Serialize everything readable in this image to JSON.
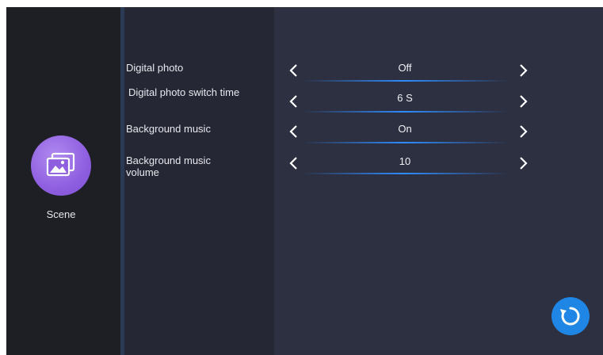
{
  "sidebar": {
    "label": "Scene",
    "icon": "photo-gallery-icon",
    "icon_color": "#8f5fe0"
  },
  "settings": [
    {
      "label": "Digital photo",
      "value": "Off"
    },
    {
      "label": "Digital photo switch time",
      "value": "6 S"
    },
    {
      "label": "Background music",
      "value": "On"
    },
    {
      "label": "Background music volume",
      "value": "10"
    }
  ],
  "reset_button": {
    "icon": "reset-icon",
    "color": "#1f86e6"
  },
  "colors": {
    "background": "#2c3041",
    "sidebar": "#1e1f24",
    "accent": "#2f8cff"
  }
}
